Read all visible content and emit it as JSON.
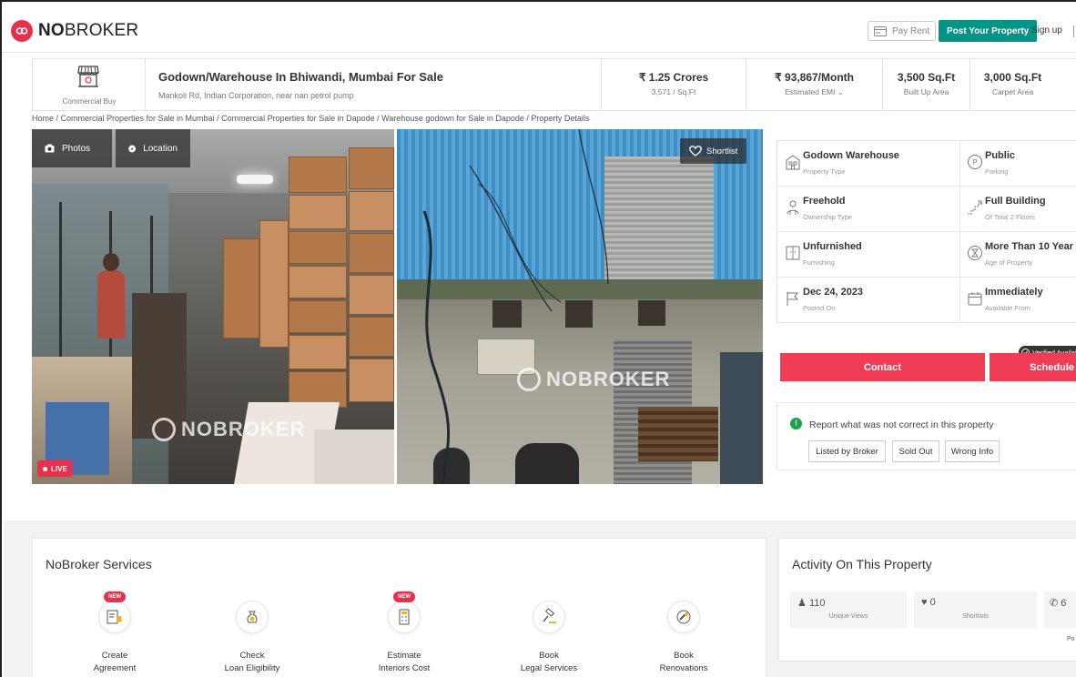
{
  "header": {
    "brand_bold": "NO",
    "brand_thin": "BROKER",
    "pay_rent": "Pay Rent",
    "post_property": "Post Your Property",
    "sign_up": "Sign up"
  },
  "property": {
    "category": "Commercial Buy",
    "title": "Godown/Warehouse In Bhiwandi, Mumbai For Sale",
    "address": "Mankoli Rd, Indian Corporation, near nan petrol pump",
    "price": "₹ 1.25 Crores",
    "price_per_sqft": "3,571 / Sq.Ft",
    "emi": "₹ 93,867/Month",
    "emi_label": "Estimated EMI ⌄",
    "built_up": "3,500 Sq.Ft",
    "built_up_label": "Built Up Area",
    "carpet": "3,000 Sq.Ft",
    "carpet_label": "Carpet Area"
  },
  "breadcrumb": "Home / Commercial Properties for Sale in Mumbai / Commercial Properties for Sale in Dapode / Warehouse godown for Sale in Dapode / Property Details",
  "gallery": {
    "photos_tab": "Photos",
    "location_tab": "Location",
    "shortlist": "Shortlist",
    "live": "LIVE",
    "watermark": "NOBROKER"
  },
  "details": [
    {
      "value": "Godown Warehouse",
      "label": "Property Type",
      "icon": "building-icon"
    },
    {
      "value": "Public",
      "label": "Parking",
      "icon": "parking-icon"
    },
    {
      "value": "Freehold",
      "label": "Ownership Type",
      "icon": "ownership-icon"
    },
    {
      "value": "Full Building",
      "label": "Of Total 2 Floors",
      "icon": "stairs-icon"
    },
    {
      "value": "Unfurnished",
      "label": "Furnishing",
      "icon": "furnishing-icon"
    },
    {
      "value": "More Than 10 Year",
      "label": "Age of Property",
      "icon": "hourglass-icon"
    },
    {
      "value": "Dec 24, 2023",
      "label": "Posted On",
      "icon": "flag-icon"
    },
    {
      "value": "Immediately",
      "label": "Available From",
      "icon": "calendar-icon"
    }
  ],
  "actions": {
    "verified": "Verified Availab",
    "contact": "Contact",
    "schedule": "Schedule"
  },
  "report": {
    "text": "Report what was not correct in this property",
    "buttons": [
      "Listed by Broker",
      "Sold Out",
      "Wrong Info"
    ]
  },
  "services": {
    "title": "NoBroker Services",
    "new_badge": "NEW",
    "items": [
      {
        "line1": "Create",
        "line2": "Agreement",
        "is_new": true
      },
      {
        "line1": "Check",
        "line2": "Loan Eligibility",
        "is_new": false
      },
      {
        "line1": "Estimate",
        "line2": "Interiors Cost",
        "is_new": true
      },
      {
        "line1": "Book",
        "line2": "Legal Services",
        "is_new": false
      },
      {
        "line1": "Book",
        "line2": "Renovations",
        "is_new": false
      }
    ]
  },
  "activity": {
    "title": "Activity On This Property",
    "views": "110",
    "views_label": "Unique Views",
    "shortlists": "0",
    "shortlists_label": "Shortlists",
    "contacts": "6",
    "tail": "Po"
  },
  "colors": {
    "brand_red": "#e8304d",
    "post_green": "#009587",
    "contact_red": "#f03d55"
  }
}
